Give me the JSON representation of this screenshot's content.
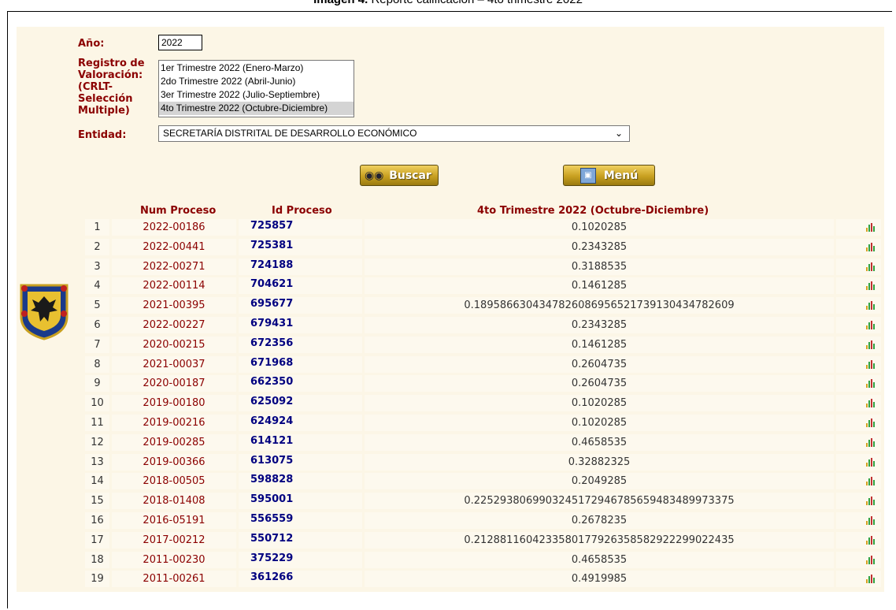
{
  "caption": {
    "bold": "Imagen 4.",
    "rest": " Reporte calificación – 4to trimestre 2022"
  },
  "form": {
    "year_label": "Año:",
    "year_value": "2022",
    "registro_label": [
      "Registro de",
      "Valoración:",
      "(CRLT-",
      "Selección",
      "Multiple)"
    ],
    "registro_options": [
      "1er Trimestre 2022 (Enero-Marzo)",
      "2do Trimestre 2022 (Abril-Junio)",
      "3er Trimestre 2022 (Julio-Septiembre)",
      "4to Trimestre 2022 (Octubre-Diciembre)"
    ],
    "registro_selected": "4to Trimestre 2022 (Octubre-Diciembre)",
    "entidad_label": "Entidad:",
    "entidad_value": "SECRETARÍA DISTRITAL DE DESARROLLO ECONÓMICO"
  },
  "buttons": {
    "buscar": "Buscar",
    "menu": "Menú"
  },
  "table": {
    "headers": {
      "num": "Num Proceso",
      "id": "Id Proceso",
      "val": "4to Trimestre 2022 (Octubre-Diciembre)"
    },
    "rows": [
      {
        "idx": "1",
        "num": "2022-00186",
        "id": "725857",
        "val": "0.1020285"
      },
      {
        "idx": "2",
        "num": "2022-00441",
        "id": "725381",
        "val": "0.2343285"
      },
      {
        "idx": "3",
        "num": "2022-00271",
        "id": "724188",
        "val": "0.3188535"
      },
      {
        "idx": "4",
        "num": "2022-00114",
        "id": "704621",
        "val": "0.1461285"
      },
      {
        "idx": "5",
        "num": "2021-00395",
        "id": "695677",
        "val": "0.1895866304347826086956521739130434782609"
      },
      {
        "idx": "6",
        "num": "2022-00227",
        "id": "679431",
        "val": "0.2343285"
      },
      {
        "idx": "7",
        "num": "2020-00215",
        "id": "672356",
        "val": "0.1461285"
      },
      {
        "idx": "8",
        "num": "2021-00037",
        "id": "671968",
        "val": "0.2604735"
      },
      {
        "idx": "9",
        "num": "2020-00187",
        "id": "662350",
        "val": "0.2604735"
      },
      {
        "idx": "10",
        "num": "2019-00180",
        "id": "625092",
        "val": "0.1020285"
      },
      {
        "idx": "11",
        "num": "2019-00216",
        "id": "624924",
        "val": "0.1020285"
      },
      {
        "idx": "12",
        "num": "2019-00285",
        "id": "614121",
        "val": "0.4658535"
      },
      {
        "idx": "13",
        "num": "2019-00366",
        "id": "613075",
        "val": "0.32882325"
      },
      {
        "idx": "14",
        "num": "2018-00505",
        "id": "598828",
        "val": "0.2049285"
      },
      {
        "idx": "15",
        "num": "2018-01408",
        "id": "595001",
        "val": "0.2252938069903245172946785659483489973375"
      },
      {
        "idx": "16",
        "num": "2016-05191",
        "id": "556559",
        "val": "0.2678235"
      },
      {
        "idx": "17",
        "num": "2017-00212",
        "id": "550712",
        "val": "0.2128811604233580177926358582922299022435"
      },
      {
        "idx": "18",
        "num": "2011-00230",
        "id": "375229",
        "val": "0.4658535"
      },
      {
        "idx": "19",
        "num": "2011-00261",
        "id": "361266",
        "val": "0.4919985"
      }
    ]
  },
  "icons": {
    "chart": "bar-chart-icon",
    "seal": "bogota-coat-of-arms-icon",
    "buscar": "binoculars-icon",
    "menu": "window-icon"
  }
}
